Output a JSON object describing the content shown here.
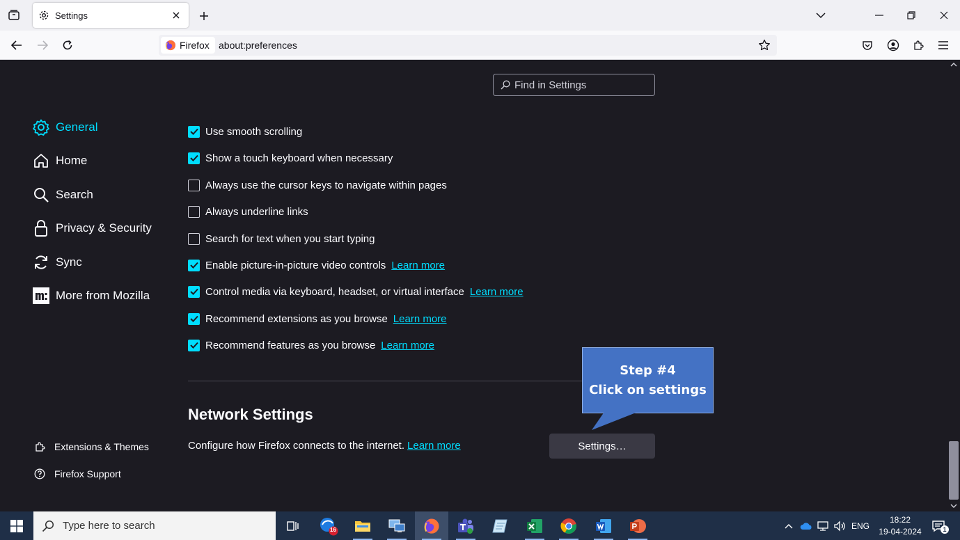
{
  "browser": {
    "tab": {
      "title": "Settings"
    },
    "identity_label": "Firefox",
    "url": "about:preferences"
  },
  "search": {
    "placeholder": "Find in Settings"
  },
  "sidebar": {
    "categories": [
      {
        "label": "General",
        "icon": "gear-icon",
        "selected": true
      },
      {
        "label": "Home",
        "icon": "home-icon"
      },
      {
        "label": "Search",
        "icon": "search-icon"
      },
      {
        "label": "Privacy & Security",
        "icon": "lock-icon"
      },
      {
        "label": "Sync",
        "icon": "sync-icon"
      },
      {
        "label": "More from Mozilla",
        "icon": "mozilla-icon"
      }
    ],
    "footer": [
      {
        "label": "Extensions & Themes",
        "icon": "puzzle-icon"
      },
      {
        "label": "Firefox Support",
        "icon": "help-icon"
      }
    ]
  },
  "options": [
    {
      "label": "Use smooth scrolling",
      "checked": true
    },
    {
      "label": "Show a touch keyboard when necessary",
      "checked": true
    },
    {
      "label": "Always use the cursor keys to navigate within pages",
      "checked": false
    },
    {
      "label": "Always underline links",
      "checked": false
    },
    {
      "label": "Search for text when you start typing",
      "checked": false
    },
    {
      "label": "Enable picture-in-picture video controls",
      "checked": true,
      "link": "Learn more"
    },
    {
      "label": "Control media via keyboard, headset, or virtual interface",
      "checked": true,
      "link": "Learn more"
    },
    {
      "label": "Recommend extensions as you browse",
      "checked": true,
      "link": "Learn more"
    },
    {
      "label": "Recommend features as you browse",
      "checked": true,
      "link": "Learn more"
    }
  ],
  "network": {
    "title": "Network Settings",
    "description": "Configure how Firefox connects to the internet.",
    "link": "Learn more",
    "button": "Settings…"
  },
  "callout": {
    "line1": "Step #4",
    "line2": "Click on settings"
  },
  "taskbar": {
    "search_placeholder": "Type here to search",
    "outlook_badge": "16",
    "language": "ENG",
    "time": "18:22",
    "date": "19-04-2024",
    "notification_count": "1"
  },
  "colors": {
    "accent": "#00ddff",
    "page_bg": "#1c1b22",
    "callout": "#4472c4"
  }
}
